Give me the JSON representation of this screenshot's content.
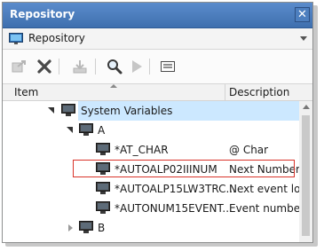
{
  "window": {
    "title": "Repository",
    "close_glyph": "✕"
  },
  "selector": {
    "value": "Repository",
    "icon": "monitor-icon"
  },
  "toolbar": {
    "buttons": [
      {
        "icon": "export-icon",
        "enabled": false
      },
      {
        "icon": "delete-x-icon",
        "enabled": true
      },
      {
        "icon": "download-icon",
        "enabled": false
      },
      {
        "icon": "search-icon",
        "enabled": true
      },
      {
        "icon": "play-icon",
        "enabled": false
      },
      {
        "icon": "properties-icon",
        "enabled": true
      }
    ]
  },
  "columns": {
    "item": "Item",
    "description": "Description"
  },
  "tree": {
    "rows": [
      {
        "label": "System Variables",
        "desc": "",
        "expander": "open",
        "selected": true
      },
      {
        "label": "A",
        "desc": "",
        "expander": "open",
        "selected": false
      },
      {
        "label": "*AT_CHAR",
        "desc": "@ Char",
        "expander": "",
        "selected": false
      },
      {
        "label": "*AUTOALP02IIINUM",
        "desc": "Next Number",
        "expander": "",
        "selected": false
      },
      {
        "label": "*AUTOALP15LW3TRC...",
        "desc": "Next event log",
        "expander": "",
        "selected": false
      },
      {
        "label": "*AUTONUM15EVENT...",
        "desc": "Event number",
        "expander": "",
        "selected": false
      },
      {
        "label": "B",
        "desc": "",
        "expander": "closed",
        "selected": false
      }
    ]
  },
  "colors": {
    "titlebar": "#4a7dbd",
    "selection": "#cce8ff",
    "highlight_border": "#d9332a"
  }
}
